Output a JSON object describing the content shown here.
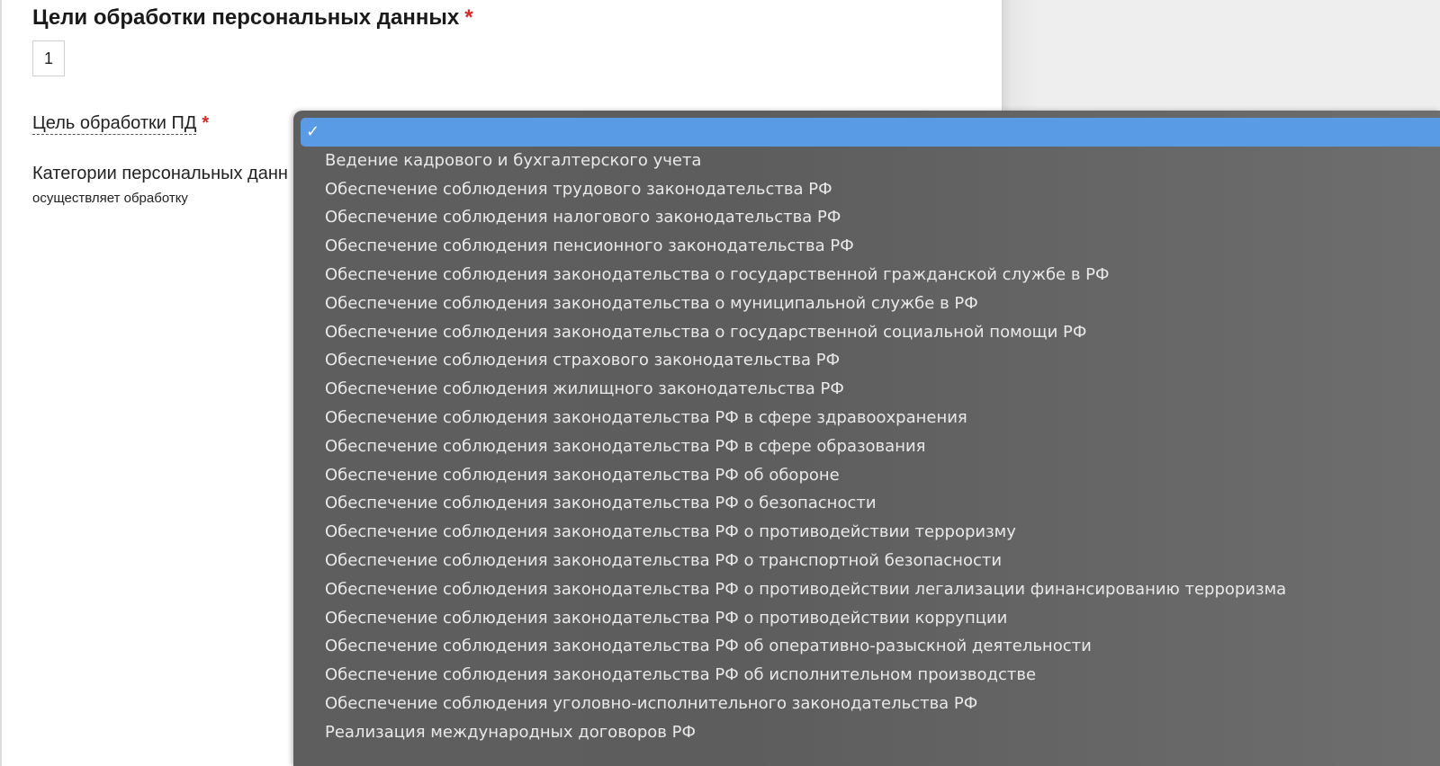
{
  "form": {
    "section_title": "Цели обработки персональных данных",
    "required_mark": "*",
    "counter_value": "1",
    "purpose_label": "Цель обработки ПД",
    "categories_label": "Категории персональных данн",
    "categories_sub": "осуществляет обработку"
  },
  "dropdown": {
    "selected_index": 0,
    "check_icon": "checkmark-icon",
    "check_glyph": "✓",
    "accent_color": "#5a9be6",
    "options": [
      "",
      "Ведение кадрового и бухгалтерского учета",
      "Обеспечение соблюдения трудового законодательства РФ",
      "Обеспечение соблюдения налогового законодательства РФ",
      "Обеспечение соблюдения пенсионного законодательства РФ",
      "Обеспечение соблюдения законодательства о государственной гражданской службе в РФ",
      "Обеспечение соблюдения законодательства о муниципальной службе в РФ",
      "Обеспечение соблюдения законодательства о государственной социальной помощи РФ",
      "Обеспечение соблюдения страхового законодательства РФ",
      "Обеспечение соблюдения жилищного законодательства РФ",
      "Обеспечение соблюдения законодательства РФ в сфере здравоохранения",
      "Обеспечение соблюдения законодательства РФ в сфере образования",
      "Обеспечение соблюдения законодательства РФ об обороне",
      "Обеспечение соблюдения законодательства РФ о безопасности",
      "Обеспечение соблюдения законодательства РФ о противодействии терроризму",
      "Обеспечение соблюдения законодательства РФ о транспортной безопасности",
      "Обеспечение соблюдения законодательства РФ о противодействии легализации финансированию терроризма",
      "Обеспечение соблюдения законодательства РФ о противодействии коррупции",
      "Обеспечение соблюдения законодательства РФ об оперативно-разыскной деятельности",
      "Обеспечение соблюдения законодательства РФ об исполнительном производстве",
      "Обеспечение соблюдения уголовно-исполнительного законодательства РФ",
      "Реализация международных договоров РФ"
    ]
  }
}
